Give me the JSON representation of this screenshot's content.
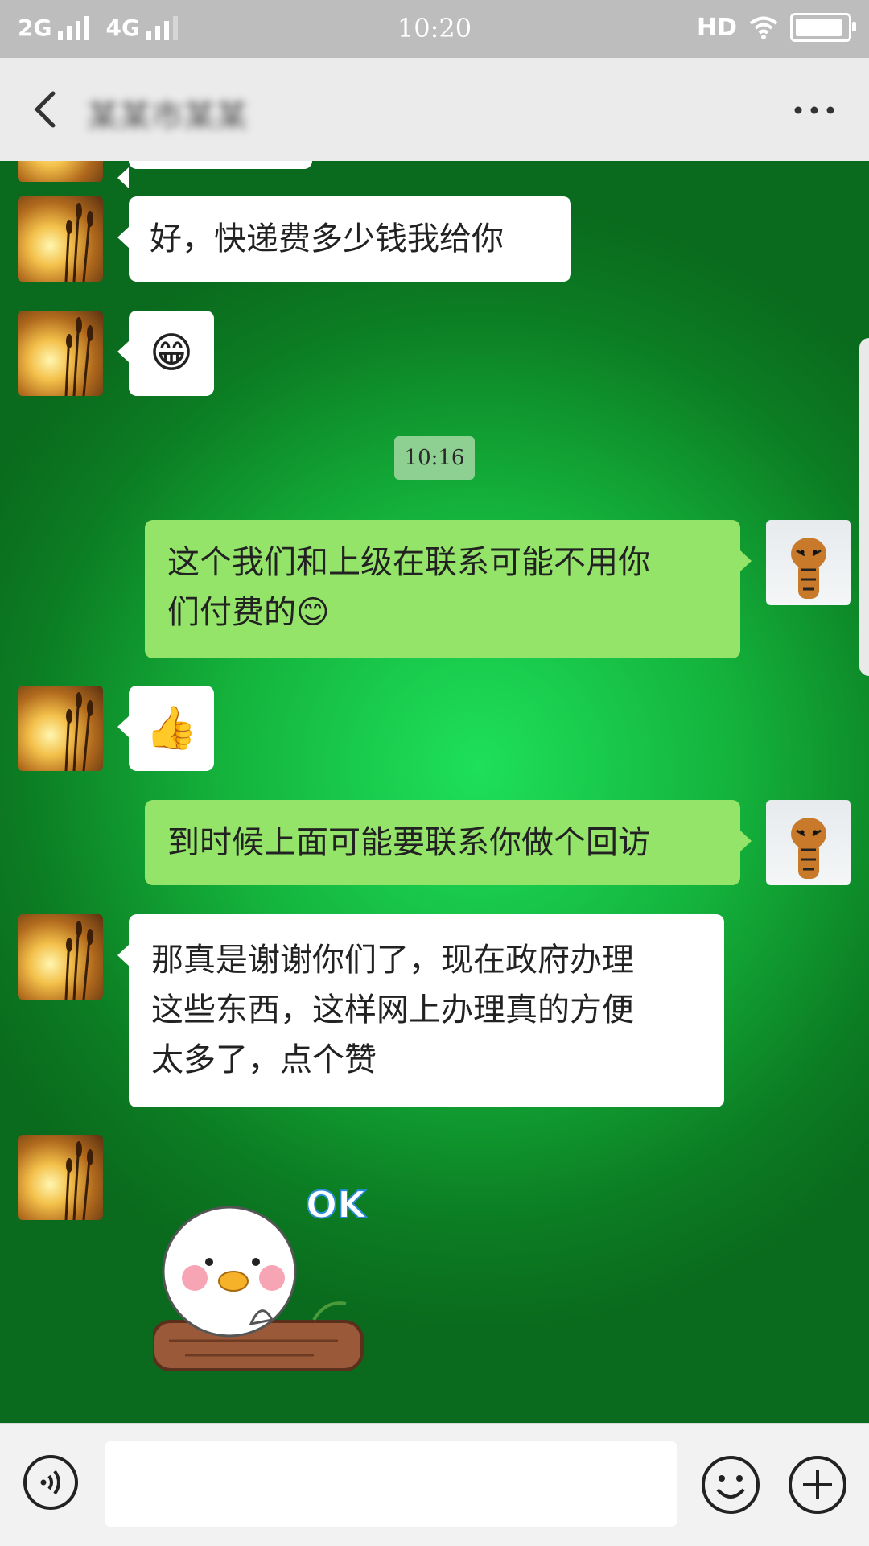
{
  "status_bar": {
    "network1": "2G",
    "network2": "4G",
    "time": "10:20",
    "hd": "HD",
    "battery_level": 0.92
  },
  "header": {
    "contact_name": "某某市某某"
  },
  "messages": [
    {
      "side": "left",
      "type": "text",
      "text": "好，快递费多少钱我给你"
    },
    {
      "side": "left",
      "type": "emoji",
      "emoji": "😁"
    },
    {
      "type": "timestamp",
      "text": "10:16"
    },
    {
      "side": "right",
      "type": "text",
      "lines": [
        "这个我们和上级在联系可能不用你",
        "们付费的😊"
      ]
    },
    {
      "side": "left",
      "type": "emoji",
      "emoji": "👍"
    },
    {
      "side": "right",
      "type": "text",
      "text": "到时候上面可能要联系你做个回访"
    },
    {
      "side": "left",
      "type": "text",
      "lines": [
        "那真是谢谢你们了，现在政府办理",
        "这些东西，这样网上办理真的方便",
        "太多了，点个赞"
      ]
    },
    {
      "side": "left",
      "type": "sticker",
      "caption": "OK"
    }
  ],
  "input": {
    "value": "",
    "placeholder": ""
  },
  "icons": {
    "back": "back-arrow-icon",
    "more": "more-dots-icon",
    "voice": "voice-icon",
    "emoji": "emoji-icon",
    "plus": "plus-icon"
  }
}
